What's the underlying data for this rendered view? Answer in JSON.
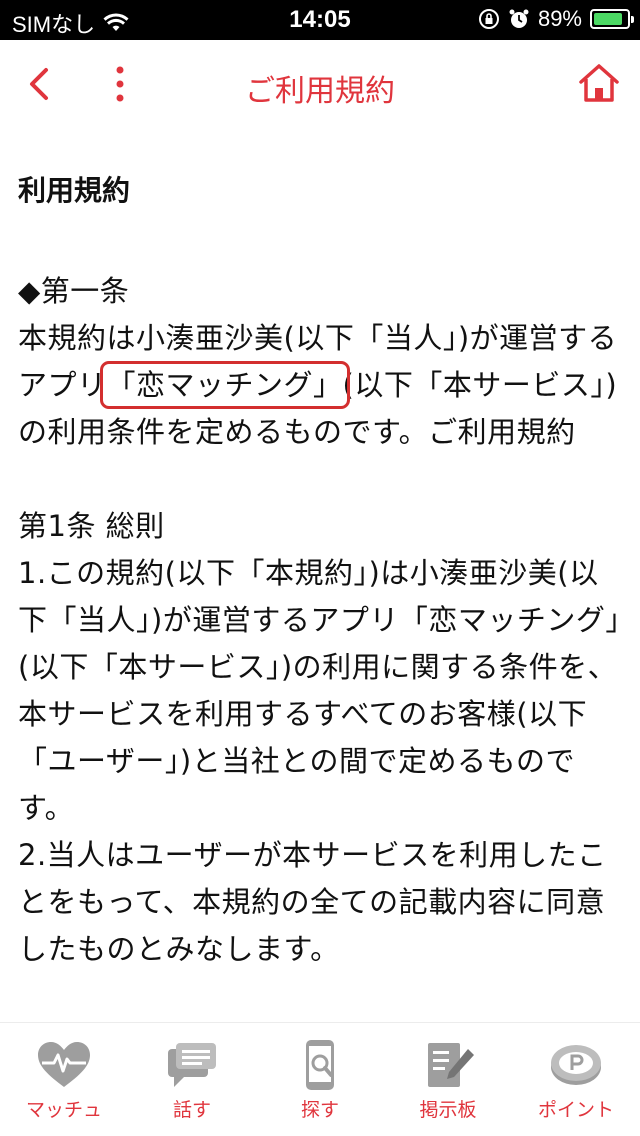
{
  "status_bar": {
    "carrier": "SIMなし",
    "time": "14:05",
    "battery_percent": "89%",
    "battery_level": 0.89,
    "battery_color": "#4cd964",
    "icons": [
      "wifi-icon",
      "rotation-lock-icon",
      "alarm-icon",
      "battery-icon"
    ]
  },
  "nav": {
    "title": "ご利用規約",
    "back_icon": "chevron-left-icon",
    "menu_icon": "vertical-dots-icon",
    "home_icon": "home-icon",
    "accent_color": "#e0353d"
  },
  "content": {
    "heading": "利用規約",
    "para1": {
      "line_article": "◆第一条",
      "text_before": "本規約は小湊亜沙美(以下「当人」)が運営するアプリ",
      "highlighted": "「恋マッチング」",
      "text_after": "(以下「本サービス」)の利用条件を定めるものです。ご利用規約"
    },
    "para2": "第1条 総則\n1.この規約(以下「本規約」)は小湊亜沙美(以下「当人」)が運営するアプリ「恋マッチング」(以下「本サービス」)の利用に関する条件を、本サービスを利用するすべてのお客様(以下「ユーザー」)と当社との間で定めるものです。\n2.当人はユーザーが本サービスを利用したことをもって、本規約の全ての記載内容に同意したものとみなします。"
  },
  "tab_bar": {
    "tabs": [
      {
        "label": "マッチュ",
        "icon": "heart-pulse-icon"
      },
      {
        "label": "話す",
        "icon": "chat-bubble-icon"
      },
      {
        "label": "探す",
        "icon": "phone-search-icon"
      },
      {
        "label": "掲示板",
        "icon": "board-edit-icon"
      },
      {
        "label": "ポイント",
        "icon": "coin-icon"
      }
    ],
    "label_color": "#e0353d",
    "icon_color": "#9e9e9e"
  }
}
